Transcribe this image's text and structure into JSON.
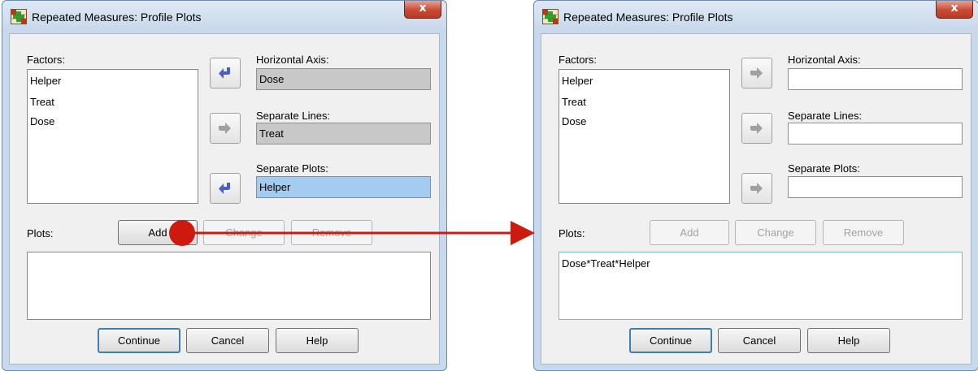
{
  "dialogs": {
    "left": {
      "title": "Repeated Measures: Profile Plots",
      "close_glyph": "x",
      "factors_label": "Factors:",
      "factors": [
        "Helper",
        "Treat",
        "Dose"
      ],
      "horizontal_axis_label": "Horizontal Axis:",
      "horizontal_axis_value": "Dose",
      "separate_lines_label": "Separate Lines:",
      "separate_lines_value": "Treat",
      "separate_plots_label": "Separate Plots:",
      "separate_plots_value": "Helper",
      "plots_label": "Plots:",
      "add_label": "Add",
      "change_label": "Change",
      "remove_label": "Remove",
      "plots_list": "",
      "continue_label": "Continue",
      "cancel_label": "Cancel",
      "help_label": "Help"
    },
    "right": {
      "title": "Repeated Measures: Profile Plots",
      "close_glyph": "x",
      "factors_label": "Factors:",
      "factors": [
        "Helper",
        "Treat",
        "Dose"
      ],
      "horizontal_axis_label": "Horizontal Axis:",
      "horizontal_axis_value": "",
      "separate_lines_label": "Separate Lines:",
      "separate_lines_value": "",
      "separate_plots_label": "Separate Plots:",
      "separate_plots_value": "",
      "plots_label": "Plots:",
      "add_label": "Add",
      "change_label": "Change",
      "remove_label": "Remove",
      "plots_list": "Dose*Treat*Helper",
      "continue_label": "Continue",
      "cancel_label": "Cancel",
      "help_label": "Help"
    }
  },
  "icons": {
    "app": "spss-grid-icon",
    "move_back": "arrow-back-icon",
    "move_right": "arrow-right-icon",
    "annotation": "red-arrow-icon"
  },
  "colors": {
    "title_close": "#c94a34",
    "selected_field": "#a4cbf0",
    "assigned_field": "#c8c8c8",
    "active_arrow": "#4a5ec9",
    "inactive_arrow": "#a0a0a0",
    "annotation_red": "#cc1a0e"
  }
}
